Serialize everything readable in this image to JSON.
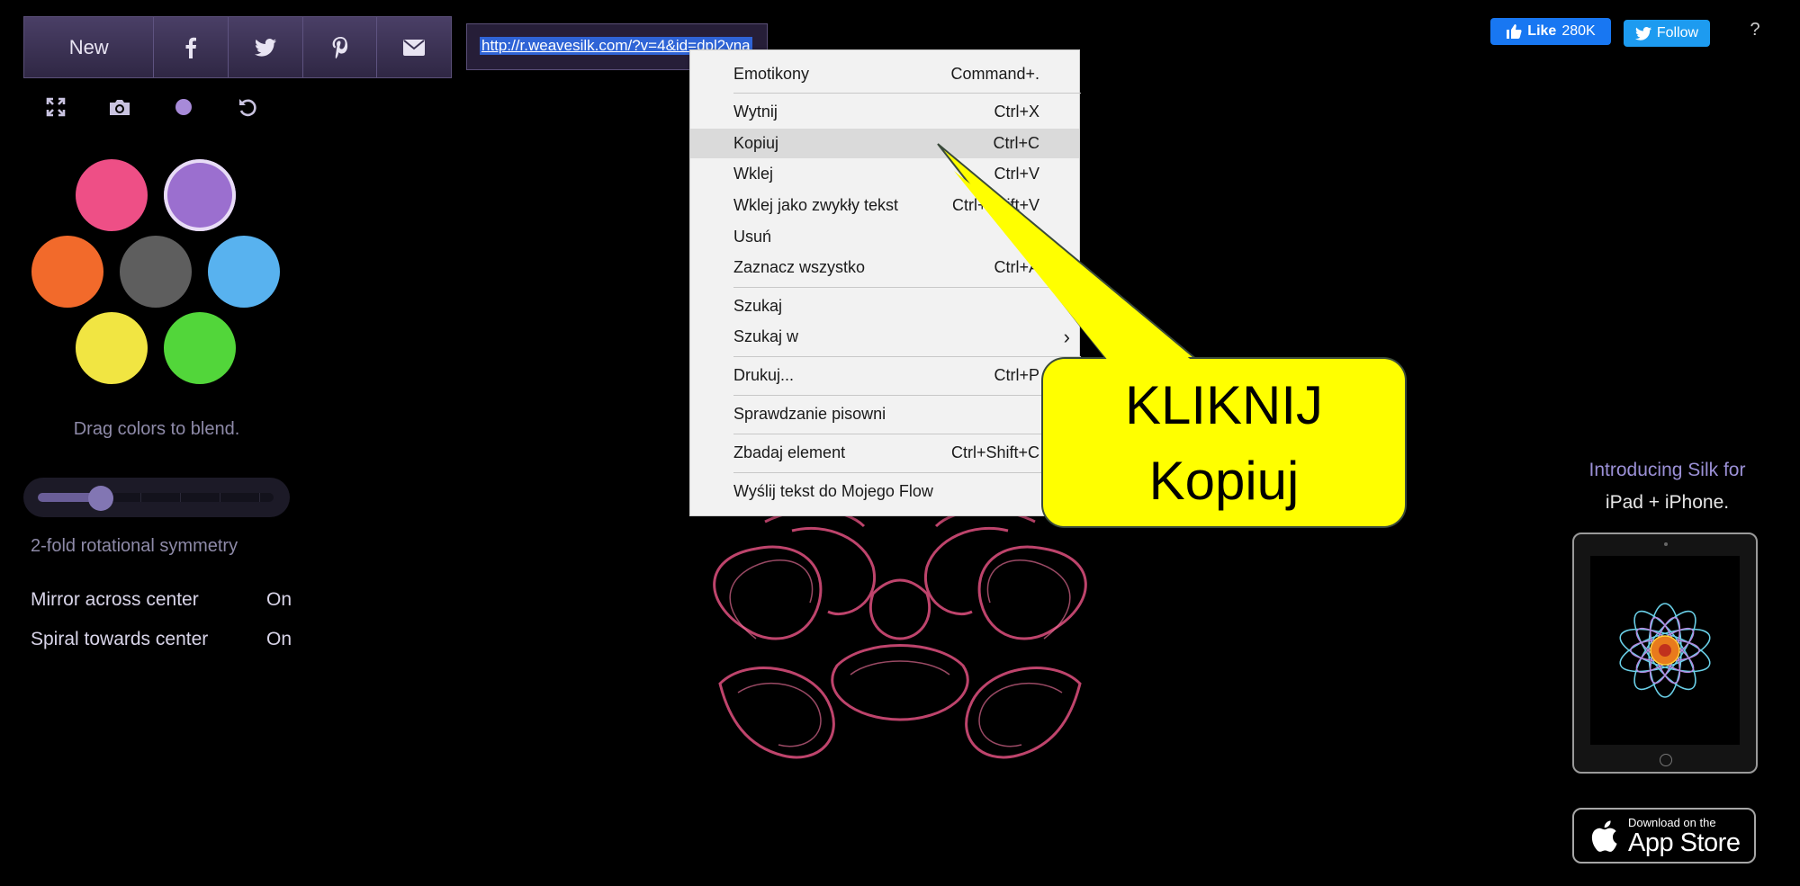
{
  "toolbar": {
    "new_label": "New",
    "share_icons": [
      "facebook-icon",
      "twitter-icon",
      "pinterest-icon",
      "email-icon"
    ]
  },
  "url_field": {
    "value": "http://r.weavesilk.com/?v=4&id=dpl2yna"
  },
  "tool_icons": [
    "fullscreen-icon",
    "camera-icon",
    "brush-size-icon",
    "undo-icon"
  ],
  "colors": {
    "swatches": [
      "#ee4f86",
      "#9b6fcf",
      "#f26a2b",
      "#5e5e5e",
      "#58b2ef",
      "#f1e542",
      "#52d63a"
    ],
    "selected": "#9b6fcf"
  },
  "hint_text": "Drag colors to blend.",
  "symmetry": {
    "label": "2-fold rotational symmetry",
    "slider_value": 2,
    "mirror": {
      "label": "Mirror across center",
      "value": "On"
    },
    "spiral": {
      "label": "Spiral towards center",
      "value": "On"
    }
  },
  "social": {
    "like_label": "Like",
    "like_count": "280K",
    "follow_label": "Follow",
    "help_label": "?"
  },
  "promo": {
    "line1": "Introducing Silk for",
    "line2": "iPad + iPhone.",
    "appstore_small": "Download on the",
    "appstore_big": "App Store"
  },
  "context_menu": {
    "items": [
      {
        "label": "Emotikony",
        "shortcut": "Command+."
      },
      {
        "label": "Wytnij",
        "shortcut": "Ctrl+X"
      },
      {
        "label": "Kopiuj",
        "shortcut": "Ctrl+C",
        "highlighted": true
      },
      {
        "label": "Wklej",
        "shortcut": "Ctrl+V"
      },
      {
        "label": "Wklej jako zwykły tekst",
        "shortcut": "Ctrl+Shift+V"
      },
      {
        "label": "Usuń",
        "shortcut": ""
      },
      {
        "label": "Zaznacz wszystko",
        "shortcut": "Ctrl+A"
      },
      {
        "label": "Szukaj",
        "shortcut": ""
      },
      {
        "label": "Szukaj w",
        "shortcut": "›"
      },
      {
        "label": "Drukuj...",
        "shortcut": "Ctrl+P"
      },
      {
        "label": "Sprawdzanie pisowni",
        "shortcut": ""
      },
      {
        "label": "Zbadaj element",
        "shortcut": "Ctrl+Shift+C"
      },
      {
        "label": "Wyślij tekst do Mojego Flow",
        "shortcut": ""
      }
    ]
  },
  "callout": {
    "line1": "KLIKNIJ",
    "line2": "Kopiuj",
    "color": "#ffff00"
  }
}
